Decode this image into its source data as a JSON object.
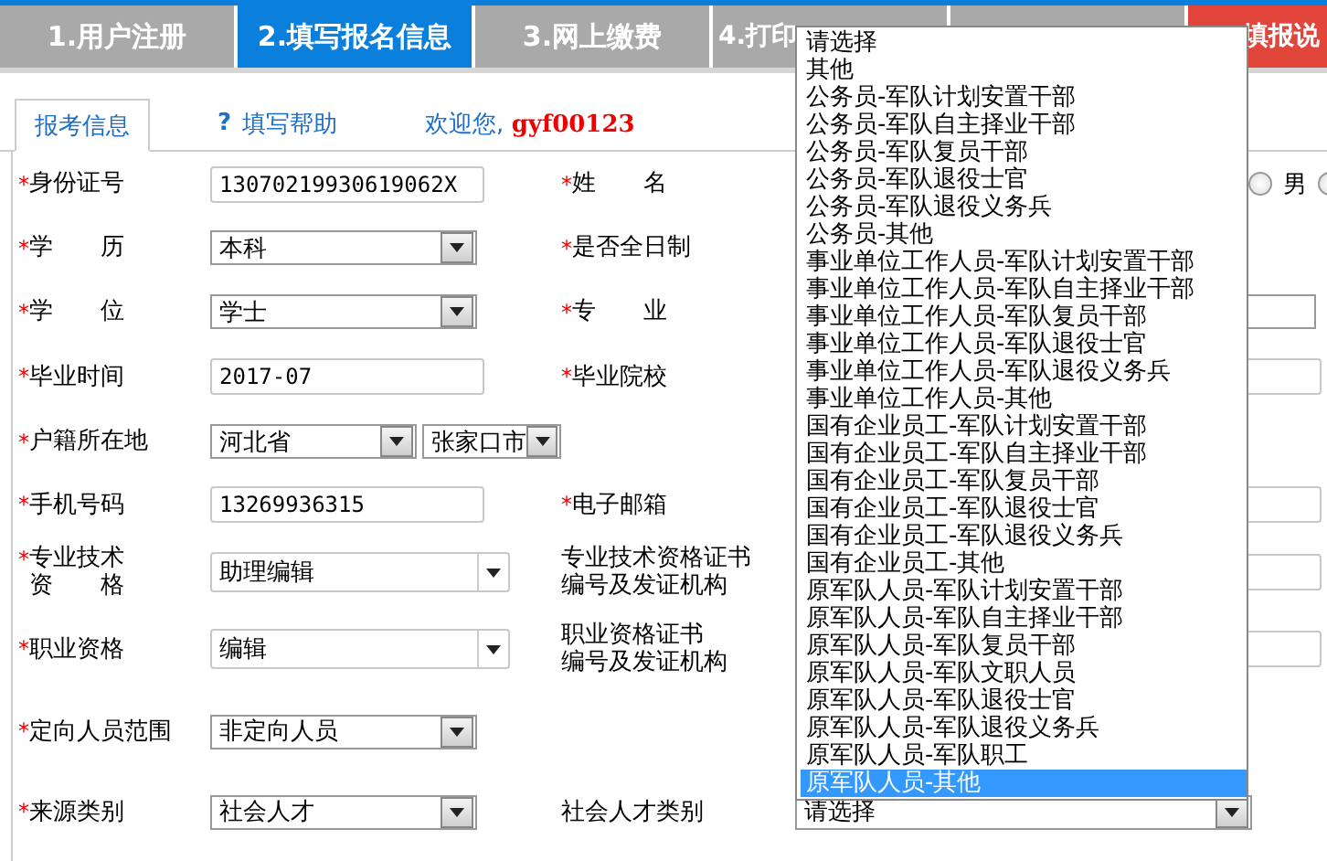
{
  "steps": [
    {
      "label": "1.用户注册",
      "kind": "normal",
      "selected": false
    },
    {
      "label": "2.填写报名信息",
      "kind": "normal",
      "selected": true
    },
    {
      "label": "3.网上缴费",
      "kind": "normal",
      "selected": false
    },
    {
      "label": "4.打印",
      "kind": "normal",
      "selected": false
    },
    {
      "kind": "normal",
      "selected": false
    },
    {
      "label": "填报说",
      "kind": "notice",
      "selected": false
    }
  ],
  "subtabs": [
    {
      "label": "报考信息",
      "kind": "tab",
      "selected": true
    },
    {
      "label": "填写帮助",
      "icon": "?",
      "kind": "link",
      "selected": false
    }
  ],
  "welcome": {
    "text": "欢迎您,",
    "user": "gyf00123"
  },
  "rows": [
    {
      "left": {
        "star": "*",
        "label": [
          "身份证号"
        ],
        "kind": "text",
        "value": "13070219930619062X"
      },
      "right": {
        "star": "*",
        "label": [
          "姓　　名"
        ],
        "kind": "radio",
        "options": [
          {
            "label": "男",
            "checked": false
          },
          {
            "checked": false
          }
        ]
      }
    },
    {
      "left": {
        "star": "*",
        "label": [
          "学　　历"
        ],
        "kind": "select",
        "value": "本科"
      },
      "right": {
        "star": "*",
        "label": [
          "是否全日制"
        ],
        "kind": "none"
      }
    },
    {
      "left": {
        "star": "*",
        "label": [
          "学　　位"
        ],
        "kind": "select",
        "value": "学士"
      },
      "right": {
        "star": "*",
        "label": [
          "专　　业"
        ],
        "kind": "select"
      }
    },
    {
      "left": {
        "star": "*",
        "label": [
          "毕业时间"
        ],
        "kind": "text",
        "value": "2017-07"
      },
      "right": {
        "star": "*",
        "label": [
          "毕业院校"
        ],
        "kind": "text"
      }
    },
    {
      "left": {
        "star": "*",
        "label": [
          "户籍所在地"
        ],
        "kind": "pair",
        "value": "河北省",
        "value2": "张家口市"
      },
      "right": {
        "kind": "none"
      }
    },
    {
      "left": {
        "star": "*",
        "label": [
          "手机号码"
        ],
        "kind": "text",
        "value": "13269936315"
      },
      "right": {
        "star": "*",
        "label": [
          "电子邮箱"
        ],
        "kind": "text"
      }
    },
    {
      "left": {
        "star": "*",
        "label": [
          "专业技术",
          "资　　格"
        ],
        "kind": "combo",
        "value": "助理编辑"
      },
      "right": {
        "label": [
          "专业技术资格证书",
          "编号及发证机构"
        ],
        "kind": "text"
      }
    },
    {
      "left": {
        "star": "*",
        "label": [
          "职业资格"
        ],
        "kind": "combo",
        "value": "编辑"
      },
      "right": {
        "label": [
          "职业资格证书",
          "编号及发证机构"
        ],
        "kind": "text"
      }
    },
    {
      "left": {
        "star": "*",
        "label": [
          "定向人员范围"
        ],
        "kind": "select",
        "value": "非定向人员"
      },
      "right": {
        "kind": "none"
      }
    },
    {
      "left": {
        "star": "*",
        "label": [
          "来源类别"
        ],
        "kind": "select",
        "value": "社会人才"
      },
      "right": {
        "label": [
          "社会人才类别"
        ],
        "kind": "open-select",
        "value": "请选择"
      }
    }
  ],
  "dropdown": [
    {
      "label": "请选择",
      "selected": false
    },
    {
      "label": "其他",
      "selected": false
    },
    {
      "label": "公务员-军队计划安置干部",
      "selected": false
    },
    {
      "label": "公务员-军队自主择业干部",
      "selected": false
    },
    {
      "label": "公务员-军队复员干部",
      "selected": false
    },
    {
      "label": "公务员-军队退役士官",
      "selected": false
    },
    {
      "label": "公务员-军队退役义务兵",
      "selected": false
    },
    {
      "label": "公务员-其他",
      "selected": false
    },
    {
      "label": "事业单位工作人员-军队计划安置干部",
      "selected": false
    },
    {
      "label": "事业单位工作人员-军队自主择业干部",
      "selected": false
    },
    {
      "label": "事业单位工作人员-军队复员干部",
      "selected": false
    },
    {
      "label": "事业单位工作人员-军队退役士官",
      "selected": false
    },
    {
      "label": "事业单位工作人员-军队退役义务兵",
      "selected": false
    },
    {
      "label": "事业单位工作人员-其他",
      "selected": false
    },
    {
      "label": "国有企业员工-军队计划安置干部",
      "selected": false
    },
    {
      "label": "国有企业员工-军队自主择业干部",
      "selected": false
    },
    {
      "label": "国有企业员工-军队复员干部",
      "selected": false
    },
    {
      "label": "国有企业员工-军队退役士官",
      "selected": false
    },
    {
      "label": "国有企业员工-军队退役义务兵",
      "selected": false
    },
    {
      "label": "国有企业员工-其他",
      "selected": false
    },
    {
      "label": "原军队人员-军队计划安置干部",
      "selected": false
    },
    {
      "label": "原军队人员-军队自主择业干部",
      "selected": false
    },
    {
      "label": "原军队人员-军队复员干部",
      "selected": false
    },
    {
      "label": "原军队人员-军队文职人员",
      "selected": false
    },
    {
      "label": "原军队人员-军队退役士官",
      "selected": false
    },
    {
      "label": "原军队人员-军队退役义务兵",
      "selected": false
    },
    {
      "label": "原军队人员-军队职工",
      "selected": false
    },
    {
      "label": "原军队人员-其他",
      "selected": true
    }
  ]
}
